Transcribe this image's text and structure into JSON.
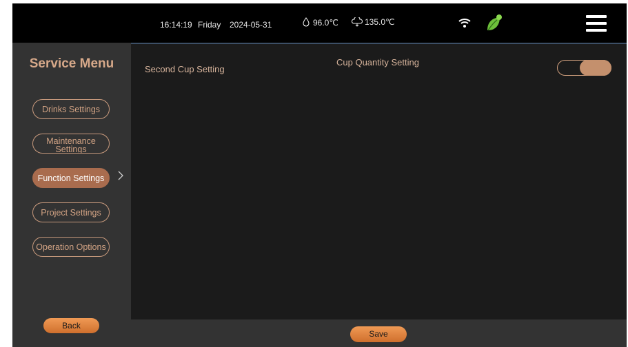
{
  "status_bar": {
    "time": "16:14:19",
    "day": "Friday",
    "date": "2024-05-31",
    "temperature_1": "96.0℃",
    "temperature_2": "135.0℃",
    "icons": [
      "water-drop-icon",
      "steam-icon",
      "wifi-icon",
      "eco-leaf-icon",
      "hamburger-menu-icon"
    ]
  },
  "sidebar": {
    "title": "Service Menu",
    "items": [
      {
        "label": "Drinks Settings"
      },
      {
        "label": "Maintenance Settings"
      },
      {
        "label": "Function Settings",
        "active": true
      },
      {
        "label": "Project Settings"
      },
      {
        "label": "Operation Options"
      }
    ],
    "back_label": "Back"
  },
  "main": {
    "second_cup_label": "Second Cup Setting",
    "cup_quantity_label": "Cup Quantity Setting",
    "toggle_state": "on"
  },
  "footer": {
    "save_label": "Save"
  },
  "colors": {
    "accent": "#c4906d",
    "active_item": "#a96c4e",
    "button_orange": "#e4843f",
    "leaf_green": "#6cbf3a"
  }
}
